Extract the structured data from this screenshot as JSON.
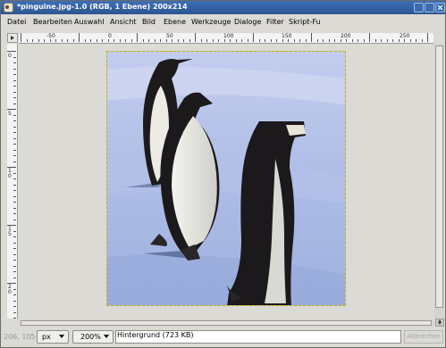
{
  "window": {
    "title": "*pinguine.jpg-1.0 (RGB, 1 Ebene) 200x214"
  },
  "menu": [
    {
      "label": "Datei"
    },
    {
      "label": "Bearbeiten"
    },
    {
      "label": "Auswahl"
    },
    {
      "label": "Ansicht"
    },
    {
      "label": "Bild"
    },
    {
      "label": "Ebene"
    },
    {
      "label": "Werkzeuge"
    },
    {
      "label": "Dialoge"
    },
    {
      "label": "Filter"
    },
    {
      "label": "Skript-Fu"
    }
  ],
  "rulers": {
    "horizontal_labels": [
      "-50",
      "0",
      "50",
      "100",
      "150",
      "200",
      "250"
    ],
    "vertical_labels": [
      "0",
      "5",
      "1 0",
      "1 5",
      "2 0"
    ]
  },
  "status": {
    "coords": "206, 105",
    "unit": "px",
    "zoom": "200%",
    "layer": "Hintergrund (723 KB)",
    "cancel": "Abbrechen"
  },
  "colors": {
    "title_bar": "#2f5c9c",
    "selection_border": "#c9b200",
    "snow": "#c8d4ef"
  }
}
